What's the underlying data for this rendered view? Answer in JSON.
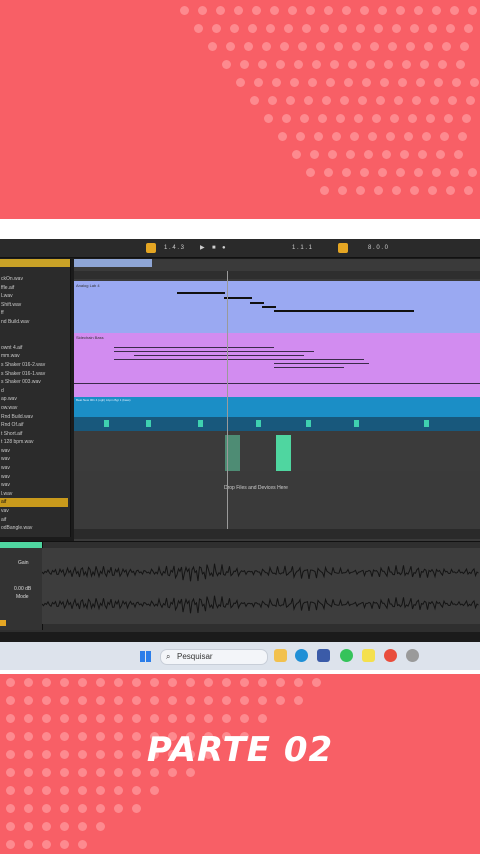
{
  "daw": {
    "transport": {
      "position": "1 . 4 . 3",
      "loop_start": "1 . 1 . 1",
      "loop_length": "8 . 0 . 0"
    },
    "browser": {
      "files": [
        "ckOn.wav",
        "ffle.aif",
        "Lwav",
        "Shift.wav",
        "ff",
        "nd Build.wav",
        "",
        "",
        "ownt 4.aif",
        "mm.wav",
        "s Shaker 016-2.wav",
        "s Shaker 016-1.wav",
        "s Shaker 003.wav",
        "d",
        "ap.wav",
        "ow.wav",
        "Rnd Build.wav",
        "Rnd Of.aif",
        "t Short.aif",
        "t 128 bpm.wav",
        "wav",
        "wav",
        "wav",
        "wav",
        "wav",
        "l.wav",
        "aif",
        "vav",
        "aif",
        "odBangle.wav"
      ],
      "selected_index": 26
    },
    "tracks": {
      "track1_name": "Analog Lab 4",
      "track2_name": "Sidechain Bass",
      "track3_name": "Beat New 001 4 (ugh) Lbpm Bgt 1 (bass)"
    },
    "drop_hint": "Drop Files and Devices Here",
    "clip": {
      "label": "Gain",
      "gain_value": "0.00 dB",
      "mode": "Mode"
    }
  },
  "taskbar": {
    "search_placeholder": "Pesquisar"
  },
  "title": "PARTE 02",
  "colors": {
    "background": "#f85f66",
    "dots": "#fd8a8f",
    "synth_lane": "#9aa9f2",
    "bass_lane": "#d28cf0",
    "drum_lane": "#1b8ec6",
    "clip_green": "#4fd6a0"
  }
}
